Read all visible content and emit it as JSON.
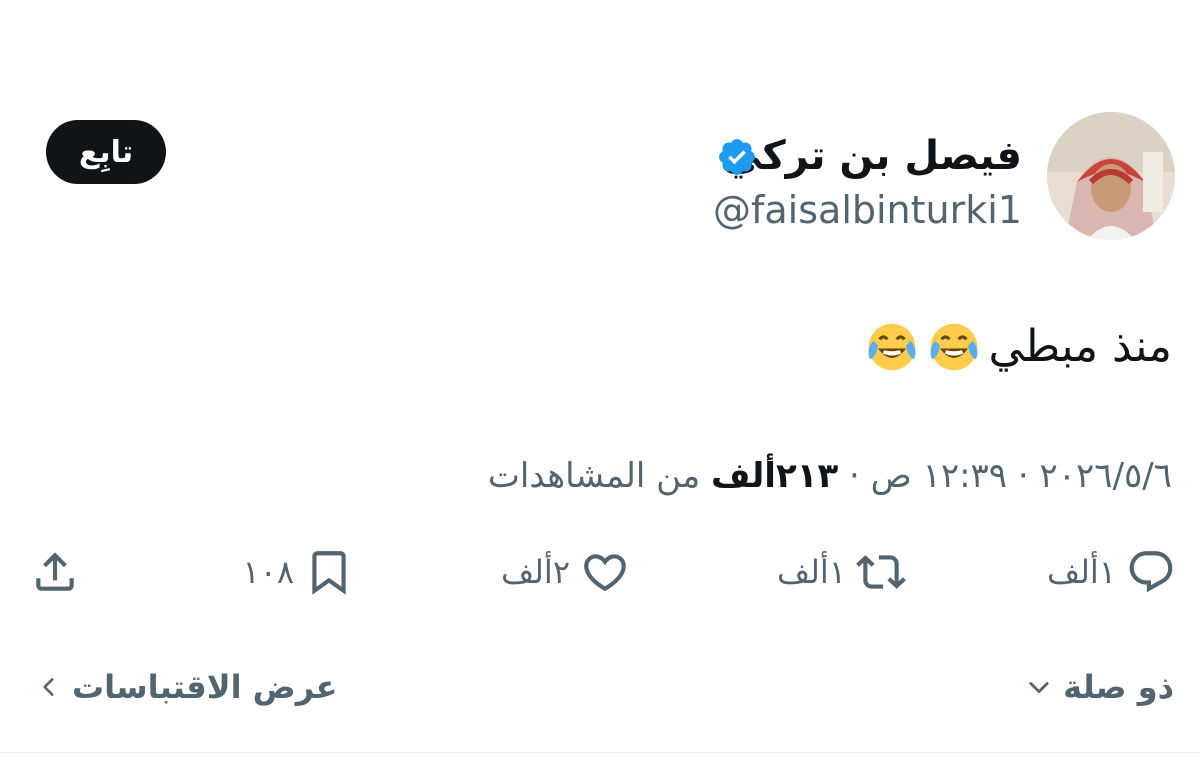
{
  "author": {
    "display_name": "فيصل بن تركي",
    "handle": "@faisalbinturki1",
    "verified": true,
    "verified_color": "#1d9bf0"
  },
  "follow_button": {
    "label": "تابِع"
  },
  "tweet": {
    "text": "منذ مبطي",
    "emojis": [
      "face-with-tears-of-joy",
      "face-with-tears-of-joy"
    ]
  },
  "meta": {
    "date": "٢٠٢٦/٥/٦",
    "separator": "·",
    "time": "١٢:٣٩ ص",
    "views_count": "٢١٣ألف",
    "views_label": "من المشاهدات"
  },
  "actions": {
    "reply_count": "١ألف",
    "retweet_count": "١ألف",
    "like_count": "٢ألف",
    "bookmark_count": "١٠٨"
  },
  "links": {
    "relevant": "ذو صلة",
    "view_quotes": "عرض الاقتباسات"
  },
  "colors": {
    "text_primary": "#0f1419",
    "text_secondary": "#536471",
    "button_bg": "#0f1419"
  }
}
